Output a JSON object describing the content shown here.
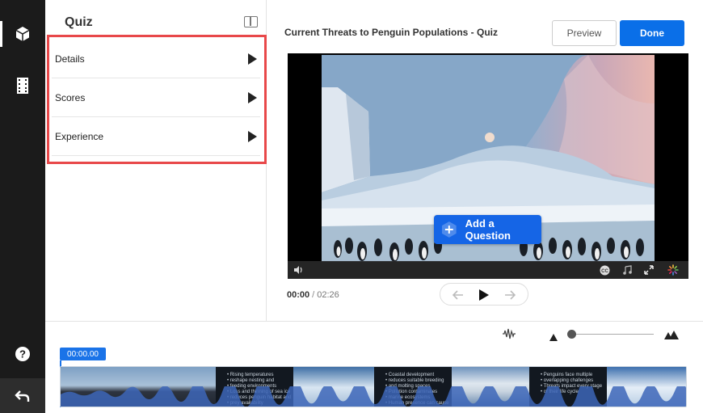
{
  "rail": {
    "icons": [
      "cube-icon",
      "film-strip-icon",
      "help-icon",
      "undo-icon"
    ]
  },
  "panel": {
    "title": "Quiz",
    "items": [
      {
        "label": "Details"
      },
      {
        "label": "Scores"
      },
      {
        "label": "Experience"
      }
    ]
  },
  "header": {
    "title": "Current Threats to Penguin Populations - Quiz",
    "preview_label": "Preview",
    "done_label": "Done"
  },
  "video": {
    "add_question_label": "Add a Question",
    "controls": [
      "volume-icon",
      "cc-icon",
      "music-icon",
      "fullscreen-icon",
      "loading-icon"
    ]
  },
  "playback": {
    "current_time": "00:00",
    "separator": "/",
    "duration": "02:26"
  },
  "timeline": {
    "timecode": "00:00.00",
    "zoom_level": 0.05,
    "slides": [
      [
        "Rising temperatures",
        "reshape nesting and",
        "feeding environments",
        "Loss and thinning of sea ice",
        "reduces penguin habitat and",
        "prey availability"
      ],
      [
        "Coastal development",
        "reduces suitable breeding",
        "and molting spaces",
        "Pollution contaminates",
        "marine ecosystems",
        "Human presence can cause"
      ],
      [
        "Penguins face multiple",
        "overlapping challenges",
        "Threats impact every stage",
        "of their life cycle"
      ]
    ]
  },
  "colors": {
    "accent": "#0a6fe8",
    "highlight": "#e8484a",
    "rail": "#1b1b1b"
  }
}
